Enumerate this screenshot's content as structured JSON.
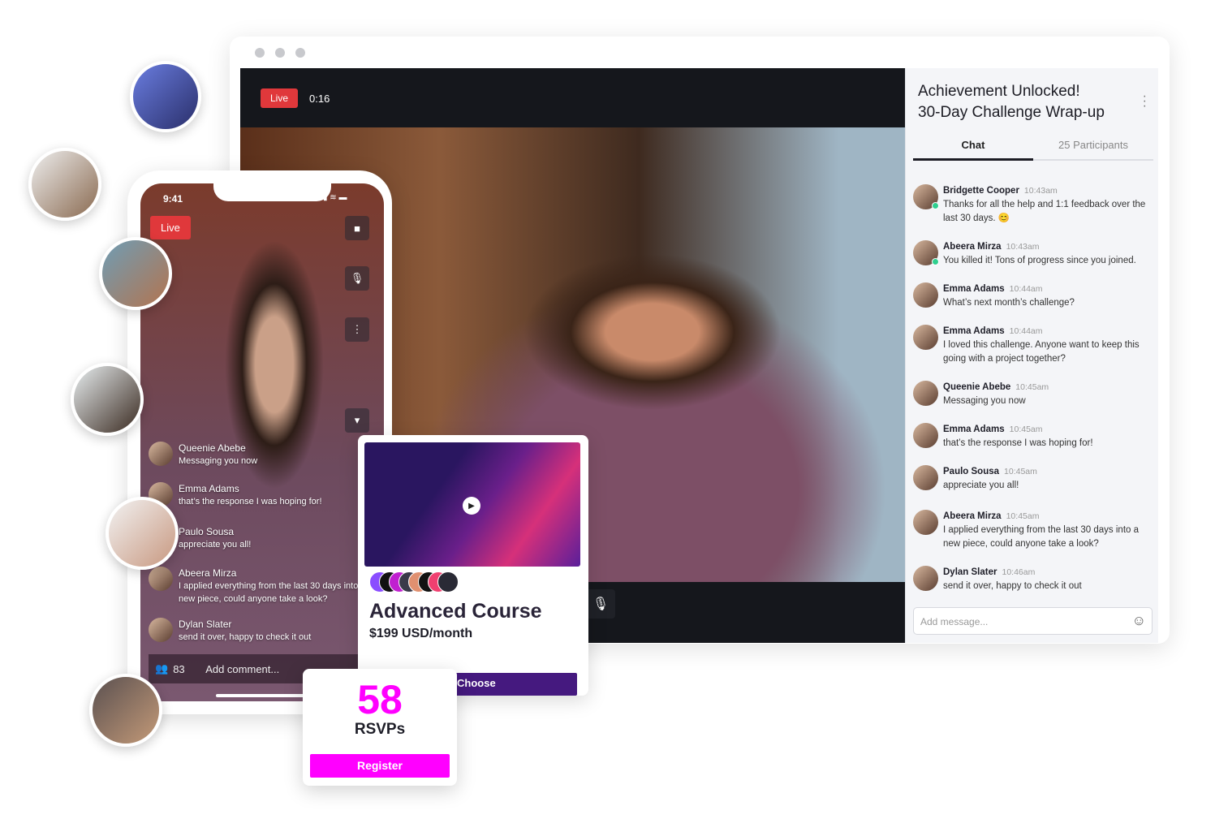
{
  "stage": {
    "live_label": "Live",
    "timer": "0:16",
    "mic_icon": "microphone-icon"
  },
  "chat": {
    "title_line1": "Achievement Unlocked!",
    "title_line2": "30-Day Challenge Wrap-up",
    "tabs": [
      {
        "label": "Chat",
        "active": true
      },
      {
        "label": "25 Participants",
        "active": false
      }
    ],
    "messages": [
      {
        "name": "Bridgette Cooper",
        "time": "10:43am",
        "text": "Thanks for all the help and 1:1 feedback over the last 30 days. 😊",
        "online": true
      },
      {
        "name": "Abeera Mirza",
        "time": "10:43am",
        "text": "You killed it! Tons of progress since you joined.",
        "online": true
      },
      {
        "name": "Emma Adams",
        "time": "10:44am",
        "text": "What’s next month’s challenge?"
      },
      {
        "name": "Emma Adams",
        "time": "10:44am",
        "text": "I loved this challenge. Anyone want to keep this going with a project together?"
      },
      {
        "name": "Queenie Abebe",
        "time": "10:45am",
        "text": "Messaging you now"
      },
      {
        "name": "Emma Adams",
        "time": "10:45am",
        "text": "that’s the response I was hoping for!"
      },
      {
        "name": "Paulo Sousa",
        "time": "10:45am",
        "text": "appreciate you all!"
      },
      {
        "name": "Abeera Mirza",
        "time": "10:45am",
        "text": "I applied everything from the last 30 days into a new piece, could anyone take a look?"
      },
      {
        "name": "Dylan Slater",
        "time": "10:46am",
        "text": "send it over, happy to check it out"
      }
    ],
    "input_placeholder": "Add message..."
  },
  "phone": {
    "time": "9:41",
    "live_label": "Live",
    "messages": [
      {
        "name": "Queenie Abebe",
        "text": "Messaging you now"
      },
      {
        "name": "Emma Adams",
        "text": "that’s the response I was hoping for!"
      },
      {
        "name": "Paulo Sousa",
        "text": "appreciate you all!"
      },
      {
        "name": "Abeera Mirza",
        "text": "I applied everything from the last 30 days into a new piece, could anyone take a look?"
      },
      {
        "name": "Dylan Slater",
        "text": "send it over, happy to check it out"
      }
    ],
    "viewer_count": "83",
    "comment_placeholder": "Add comment..."
  },
  "course": {
    "title": "Advanced Course",
    "price": "$199 USD/month",
    "button": "Choose"
  },
  "rsvp": {
    "count": "58",
    "label": "RSVPs",
    "button": "Register"
  },
  "colors": {
    "live": "#e0383b",
    "choose": "#45197f",
    "register": "#ff00ff"
  }
}
